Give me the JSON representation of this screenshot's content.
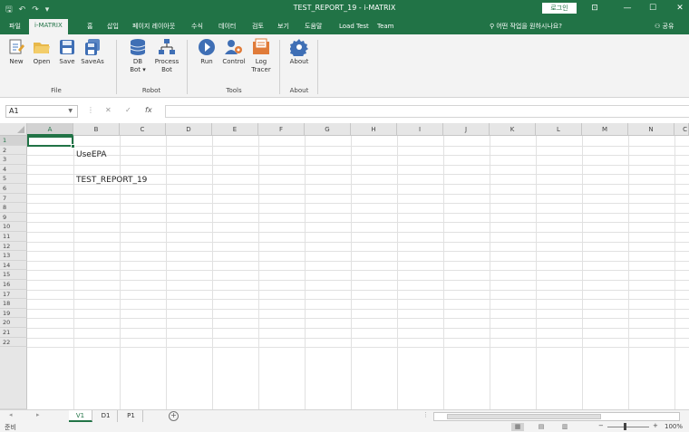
{
  "titlebar": {
    "title": "TEST_REPORT_19  -  i-MATRIX",
    "login": "로그인",
    "qa_save": "🖫",
    "qa_undo": "↶",
    "qa_redo": "↷",
    "qa_more": "▾",
    "win_ribbon": "⊡",
    "win_min": "—",
    "win_max": "☐",
    "win_close": "✕"
  },
  "tabs": [
    "파일",
    "i-MATRIX",
    "홈",
    "삽입",
    "페이지 레이아웃",
    "수식",
    "데이터",
    "검토",
    "보기",
    "도움말",
    "Load Test",
    "Team"
  ],
  "active_tab": "i-MATRIX",
  "tellme": "어떤 작업을 원하시나요?",
  "share": "공유",
  "ribbon": {
    "new": "New",
    "open": "Open",
    "save": "Save",
    "saveas": "SaveAs",
    "dbbot_1": "DB",
    "dbbot_2": "Bot ▾",
    "processbot_1": "Process",
    "processbot_2": "Bot",
    "run": "Run",
    "control": "Control",
    "logtracer_1": "Log",
    "logtracer_2": "Tracer",
    "about": "About",
    "group_file": "File",
    "group_robot": "Robot",
    "group_tools": "Tools",
    "group_about": "About"
  },
  "formula_bar": {
    "namebox": "A1",
    "fx": "fx",
    "value": ""
  },
  "columns": [
    "A",
    "B",
    "C",
    "D",
    "E",
    "F",
    "G",
    "H",
    "I",
    "J",
    "K",
    "L",
    "M",
    "N",
    "C"
  ],
  "rows": [
    "1",
    "2",
    "3",
    "4",
    "5",
    "6",
    "7",
    "8",
    "9",
    "10",
    "11",
    "12",
    "13",
    "14",
    "15",
    "16",
    "17",
    "18",
    "19",
    "20",
    "21",
    "22"
  ],
  "cells": {
    "B2": "UseEPA",
    "B4": "TEST_REPORT_19"
  },
  "sheets": [
    "V1",
    "D1",
    "P1"
  ],
  "active_sheet": "V1",
  "status": {
    "ready": "준비",
    "zoom": "100%"
  },
  "colors": {
    "accent": "#217346"
  }
}
